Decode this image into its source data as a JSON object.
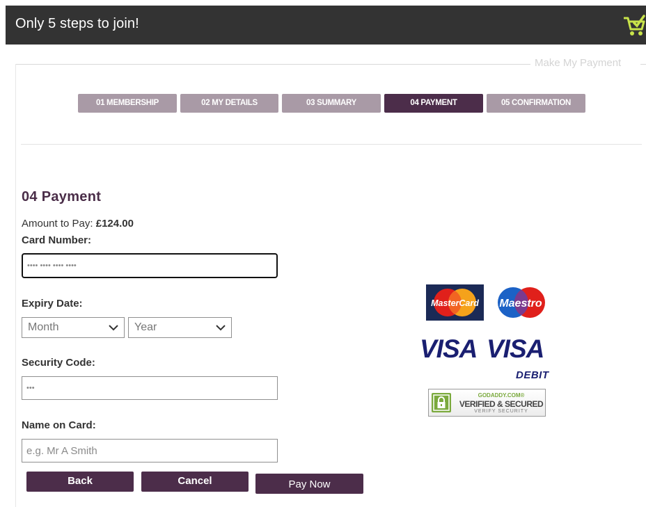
{
  "header": {
    "title": "Only 5 steps to join!",
    "cart_icon": "shopping-cart-check-icon",
    "icon_color": "#c8e34a"
  },
  "fieldset": {
    "legend": "Make My Payment"
  },
  "steps": [
    {
      "label": "01 MEMBERSHIP",
      "active": false
    },
    {
      "label": "02 MY DETAILS",
      "active": false
    },
    {
      "label": "03 SUMMARY",
      "active": false
    },
    {
      "label": "04 PAYMENT",
      "active": true
    },
    {
      "label": "05 CONFIRMATION",
      "active": false
    }
  ],
  "payment": {
    "title": "04 Payment",
    "amount_label": "Amount to Pay: ",
    "amount_value": "£124.00",
    "card_number_label": "Card Number:",
    "card_number_placeholder": "•••• •••• •••• ••••",
    "expiry_label": "Expiry Date:",
    "month_select": "Month",
    "year_select": "Year",
    "security_label": "Security Code:",
    "security_placeholder": "•••",
    "name_label": "Name on Card:",
    "name_placeholder": "e.g. Mr A Smith"
  },
  "buttons": {
    "back": "Back",
    "cancel": "Cancel",
    "pay_now": "Pay Now"
  },
  "card_logos": {
    "mastercard": "MasterCard",
    "maestro": "Maestro",
    "visa": "VISA",
    "visa_debit": "VISA",
    "debit": "DEBIT"
  },
  "seal": {
    "line1": "GODADDY.COM®",
    "line2": "VERIFIED & SECURED",
    "line3": "VERIFY SECURITY"
  },
  "colors": {
    "header_bg": "#333333",
    "step_inactive": "#a99aa6",
    "step_active": "#4c2d4a",
    "button": "#4c2d4a",
    "title": "#4a2d48"
  }
}
